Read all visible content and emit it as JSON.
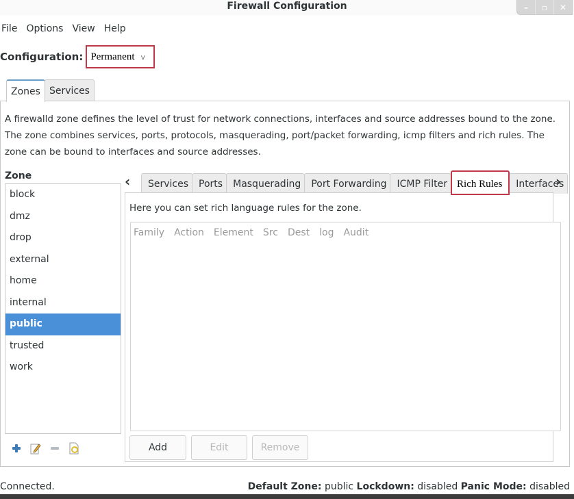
{
  "window": {
    "title": "Firewall Configuration",
    "controls": {
      "minimize": "–",
      "maximize": "▫",
      "close": "✕"
    }
  },
  "menu": [
    "File",
    "Options",
    "View",
    "Help"
  ],
  "configuration": {
    "label": "Configuration:",
    "value": "Permanent",
    "chevron": "v"
  },
  "main_tabs": [
    {
      "label": "Zones",
      "active": true
    },
    {
      "label": "Services",
      "active": false
    }
  ],
  "zones_description": "A firewalld zone defines the level of trust for network connections, interfaces and source addresses bound to the zone. The zone combines services, ports, protocols, masquerading, port/packet forwarding, icmp filters and rich rules. The zone can be bound to interfaces and source addresses.",
  "zone_list": {
    "header": "Zone",
    "items": [
      "block",
      "dmz",
      "drop",
      "external",
      "home",
      "internal",
      "public",
      "trusted",
      "work"
    ],
    "selected": "public"
  },
  "zone_tools": [
    {
      "name": "add-zone",
      "icon": "plus-icon"
    },
    {
      "name": "edit-zone",
      "icon": "edit-icon"
    },
    {
      "name": "remove-zone",
      "icon": "minus-icon"
    },
    {
      "name": "load-defaults",
      "icon": "load-defaults-icon"
    }
  ],
  "sub_nav": {
    "left": "‹",
    "right": "›"
  },
  "sub_tabs": [
    {
      "label": "Services",
      "active": false
    },
    {
      "label": "Ports",
      "active": false
    },
    {
      "label": "Masquerading",
      "active": false
    },
    {
      "label": "Port Forwarding",
      "active": false
    },
    {
      "label": "ICMP Filter",
      "active": false
    },
    {
      "label": "Rich Rules",
      "active": true
    },
    {
      "label": "Interfaces",
      "active": false
    }
  ],
  "rich_rules": {
    "description": "Here you can set rich language rules for the zone.",
    "columns": [
      "Family",
      "Action",
      "Element",
      "Src",
      "Dest",
      "log",
      "Audit"
    ],
    "rows": [],
    "buttons": {
      "add": "Add",
      "edit": "Edit",
      "remove": "Remove"
    }
  },
  "status": {
    "connection": "Connected.",
    "default_zone_label": "Default Zone:",
    "default_zone": "public",
    "lockdown_label": "Lockdown:",
    "lockdown": "disabled",
    "panic_label": "Panic Mode:",
    "panic": "disabled"
  },
  "colors": {
    "selection": "#4a90d9",
    "highlight_box": "#c0394b"
  }
}
